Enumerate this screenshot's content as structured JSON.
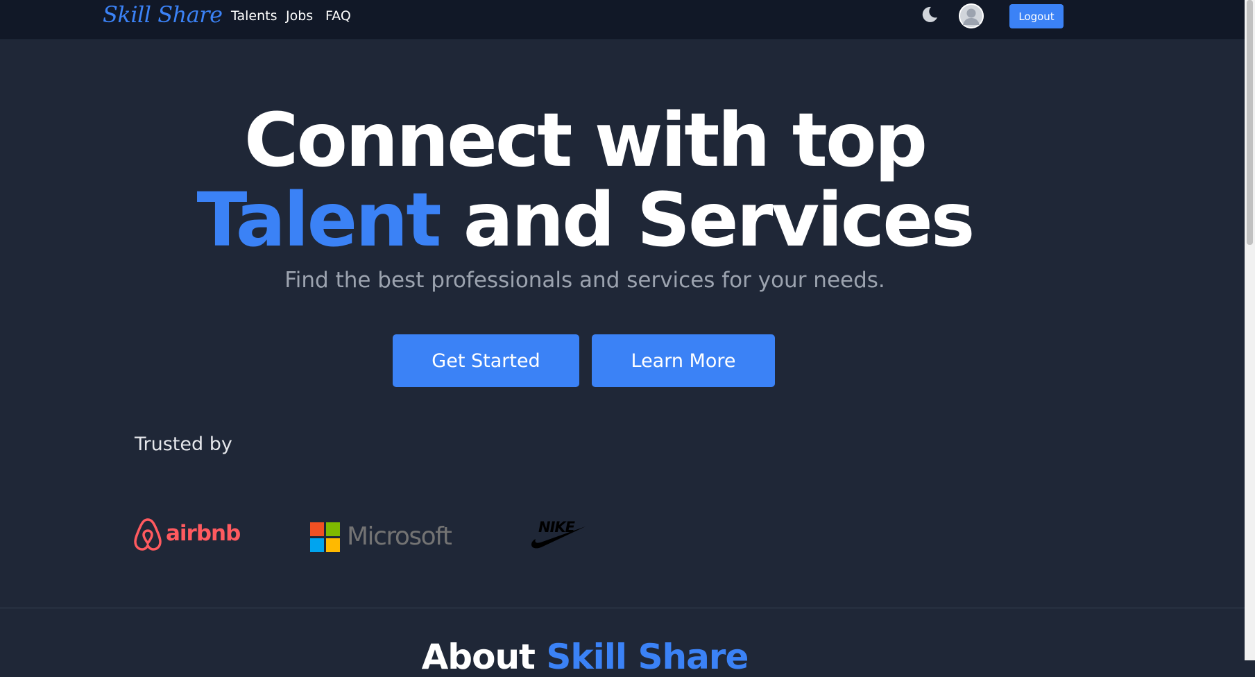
{
  "nav": {
    "brand": "Skill Share",
    "links": [
      "Talents",
      "Jobs",
      "FAQ"
    ],
    "logout_label": "Logout",
    "theme_icon": "moon-icon",
    "avatar_icon": "user-avatar-icon"
  },
  "hero": {
    "line1": "Connect with top",
    "line2_accent": "Talent",
    "line2_rest": "and Services",
    "subtitle": "Find the best professionals and services for your needs.",
    "primary_button": "Get Started",
    "secondary_button": "Learn More"
  },
  "trusted": {
    "title": "Trusted by",
    "logos": [
      {
        "name": "airbnb",
        "icon": "airbnb-logo"
      },
      {
        "name": "Microsoft",
        "icon": "microsoft-logo"
      },
      {
        "name": "NIKE",
        "icon": "nike-logo"
      }
    ]
  },
  "about": {
    "title_plain": "About",
    "title_accent": "Skill Share"
  },
  "colors": {
    "accent": "#3b82f6",
    "background": "#1f2737",
    "navbar": "#111827",
    "muted_text": "#9ca3af",
    "airbnb": "#ff5a5f",
    "microsoft_text": "#737373"
  }
}
